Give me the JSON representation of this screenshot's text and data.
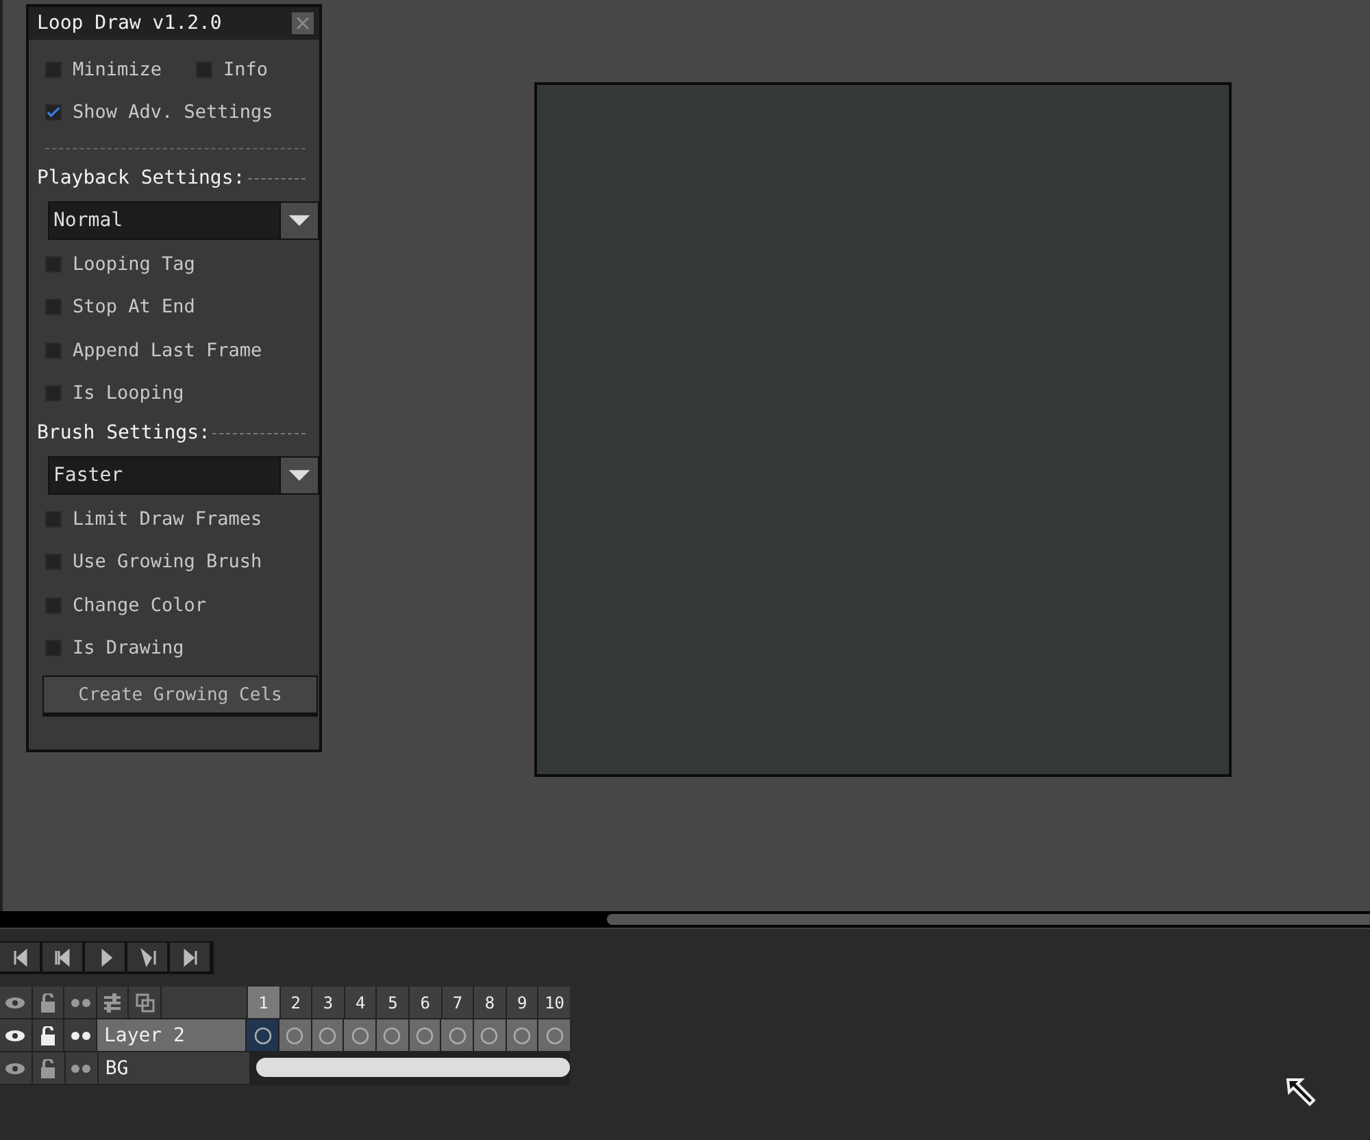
{
  "dialog": {
    "title": "Loop Draw v1.2.0",
    "top_options": [
      {
        "label": "Minimize",
        "checked": false
      },
      {
        "label": "Info",
        "checked": false
      }
    ],
    "show_advanced": {
      "label": "Show Adv. Settings",
      "checked": true
    },
    "sections": [
      {
        "title": "Playback Settings:",
        "dropdown": {
          "value": "Normal"
        },
        "options": [
          {
            "label": "Looping Tag",
            "checked": false
          },
          {
            "label": "Stop At End",
            "checked": false
          },
          {
            "label": "Append Last Frame",
            "checked": false
          },
          {
            "label": "Is Looping",
            "checked": false
          }
        ]
      },
      {
        "title": "Brush Settings:",
        "dropdown": {
          "value": "Faster"
        },
        "options": [
          {
            "label": "Limit Draw Frames",
            "checked": false
          },
          {
            "label": "Use Growing Brush",
            "checked": false
          },
          {
            "label": "Change Color",
            "checked": false
          },
          {
            "label": "Is Drawing",
            "checked": false
          }
        ]
      }
    ],
    "button": "Create Growing Cels"
  },
  "timeline": {
    "frames": [
      {
        "label": "1",
        "selected": true
      },
      {
        "label": "2",
        "selected": false
      },
      {
        "label": "3",
        "selected": false
      },
      {
        "label": "4",
        "selected": false
      },
      {
        "label": "5",
        "selected": false
      },
      {
        "label": "6",
        "selected": false
      },
      {
        "label": "7",
        "selected": false
      },
      {
        "label": "8",
        "selected": false
      },
      {
        "label": "9",
        "selected": false
      },
      {
        "label": "10",
        "selected": false
      }
    ],
    "layers": [
      {
        "name": "Layer 2",
        "selected": true,
        "kind": "empty"
      },
      {
        "name": "BG",
        "selected": false,
        "kind": "linked"
      }
    ]
  }
}
